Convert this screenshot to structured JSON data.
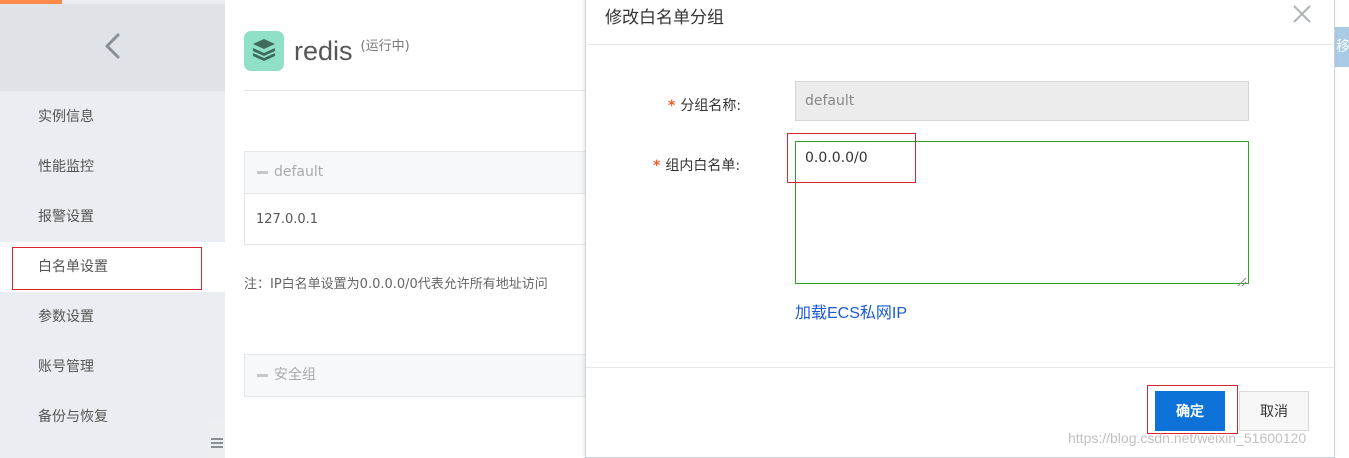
{
  "sidebar": {
    "items": [
      {
        "label": "实例信息"
      },
      {
        "label": "性能监控"
      },
      {
        "label": "报警设置"
      },
      {
        "label": "白名单设置"
      },
      {
        "label": "参数设置"
      },
      {
        "label": "账号管理"
      },
      {
        "label": "备份与恢复"
      }
    ],
    "active_index": 3
  },
  "main": {
    "instance_name": "redis",
    "instance_status": "(运行中)",
    "groups": [
      {
        "name": "default",
        "value": "127.0.0.1"
      },
      {
        "name": "安全组"
      }
    ],
    "note": "注：IP白名单设置为0.0.0.0/0代表允许所有地址访问",
    "right_button_label": "移"
  },
  "dialog": {
    "title": "修改白名单分组",
    "group_name_label": "分组名称:",
    "group_name_value": "default",
    "whitelist_label": "组内白名单:",
    "whitelist_value": "0.0.0.0/0",
    "load_link": "加载ECS私网IP",
    "ok_label": "确定",
    "cancel_label": "取消"
  },
  "colors": {
    "accent_orange": "#ff8a4c",
    "primary_button": "#0c72d8",
    "focus_border": "#2ea121",
    "required_star": "#f25a25",
    "annotation_red": "#d9232e",
    "link": "#1a5ad6"
  },
  "icons": {
    "back": "chevron-left-icon",
    "logo": "redis-stack-icon",
    "close": "close-icon"
  },
  "watermark": "https://blog.csdn.net/weixin_51600120"
}
